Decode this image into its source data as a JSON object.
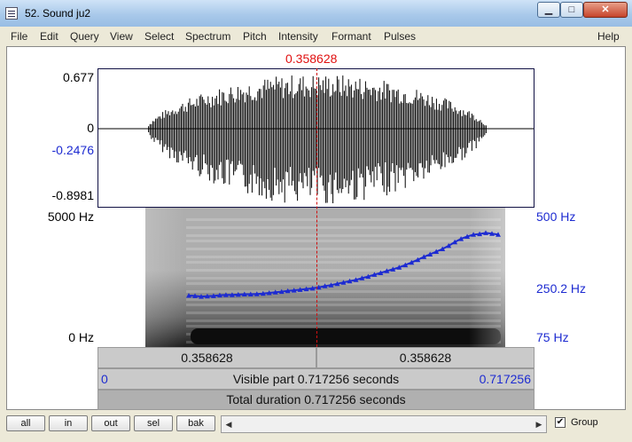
{
  "window": {
    "title": "52. Sound ju2"
  },
  "controls": {
    "minimize": "▁",
    "maximize": "□",
    "close": "✕"
  },
  "menu": [
    "File",
    "Edit",
    "Query",
    "View",
    "Select",
    "Spectrum",
    "Pitch",
    "Intensity",
    "Formant",
    "Pulses"
  ],
  "help": "Help",
  "cursor_time": "0.358628",
  "waveform": {
    "max": "0.677",
    "zero": "0",
    "cursor_value": "-0.2476",
    "min": "-0.8981"
  },
  "spectrogram": {
    "top_freq": "5000 Hz",
    "bottom_freq": "0 Hz"
  },
  "pitch_axis": {
    "top": "500 Hz",
    "mid": "250.2 Hz",
    "bottom": "75 Hz"
  },
  "pitch_track_hz": [
    232,
    231,
    229,
    230,
    231,
    233,
    234,
    234,
    235,
    236,
    236,
    237,
    238,
    240,
    242,
    244,
    246,
    248,
    250,
    252,
    254,
    257,
    261,
    264,
    268,
    272,
    276,
    280,
    285,
    290,
    296,
    301,
    307,
    312,
    318,
    325,
    333,
    341,
    350,
    358,
    366,
    374,
    384,
    395,
    405,
    412,
    418,
    420,
    423,
    421,
    418
  ],
  "selection_bar": {
    "left": "0.358628",
    "right": "0.358628"
  },
  "visible_bar": {
    "start": "0",
    "label": "Visible part 0.717256 seconds",
    "end": "0.717256"
  },
  "total_bar": {
    "label": "Total duration 0.717256 seconds"
  },
  "buttons": {
    "all": "all",
    "in": "in",
    "out": "out",
    "sel": "sel",
    "bak": "bak"
  },
  "group": {
    "label": "Group",
    "checked": true
  },
  "colors": {
    "cursor": "#e01010",
    "pitch": "#1d2bd1",
    "label_blue": "#1d2bd1"
  }
}
